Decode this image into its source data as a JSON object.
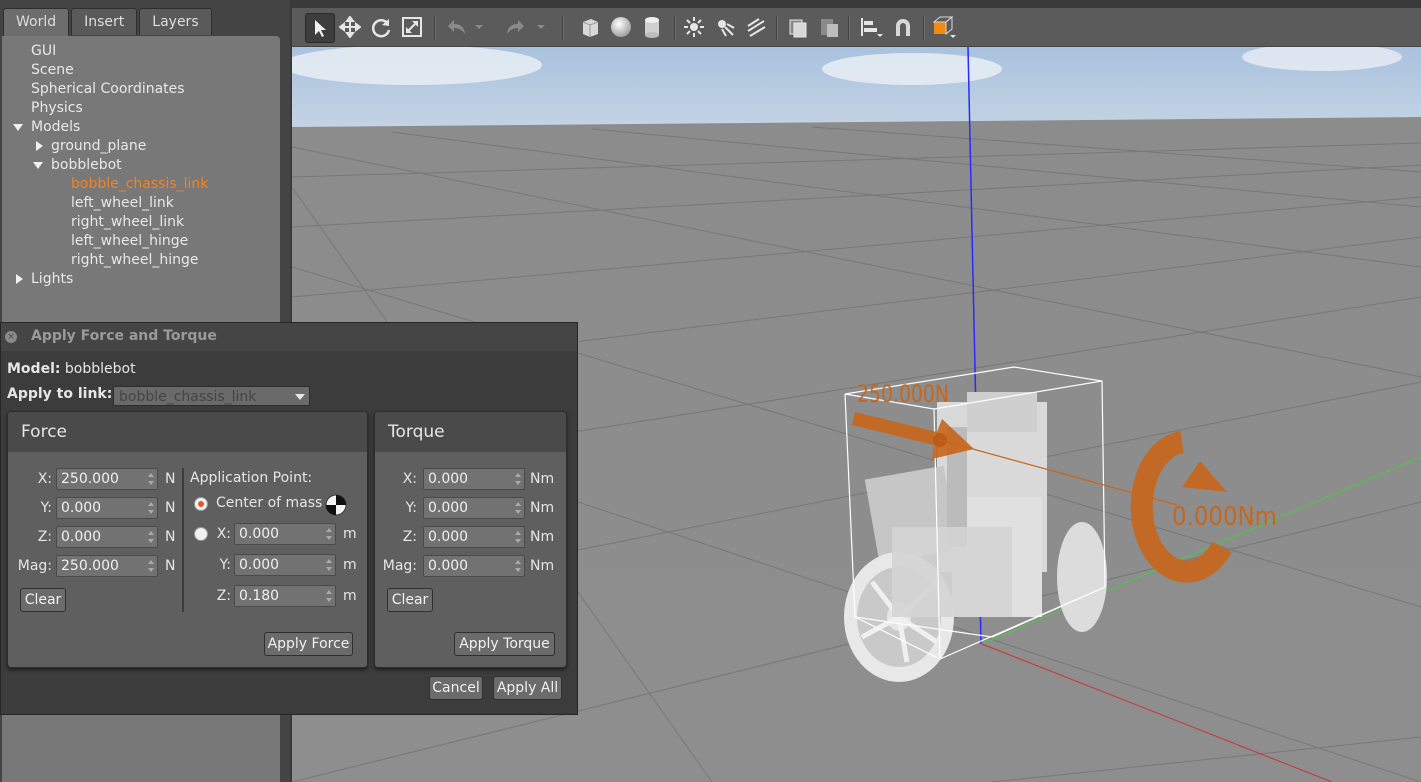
{
  "tabs": [
    "World",
    "Insert",
    "Layers"
  ],
  "tree": {
    "items": [
      {
        "label": "GUI",
        "depth": 0,
        "arrow": "none"
      },
      {
        "label": "Scene",
        "depth": 0,
        "arrow": "none"
      },
      {
        "label": "Spherical Coordinates",
        "depth": 0,
        "arrow": "none"
      },
      {
        "label": "Physics",
        "depth": 0,
        "arrow": "none"
      },
      {
        "label": "Models",
        "depth": 0,
        "arrow": "down"
      },
      {
        "label": "ground_plane",
        "depth": 1,
        "arrow": "right"
      },
      {
        "label": "bobblebot",
        "depth": 1,
        "arrow": "down"
      },
      {
        "label": "bobble_chassis_link",
        "depth": 2,
        "arrow": "none",
        "selected": true
      },
      {
        "label": "left_wheel_link",
        "depth": 2,
        "arrow": "none"
      },
      {
        "label": "right_wheel_link",
        "depth": 2,
        "arrow": "none"
      },
      {
        "label": "left_wheel_hinge",
        "depth": 2,
        "arrow": "none"
      },
      {
        "label": "right_wheel_hinge",
        "depth": 2,
        "arrow": "none"
      },
      {
        "label": "Lights",
        "depth": 0,
        "arrow": "right"
      }
    ]
  },
  "toolbar": {
    "icons": [
      "select-icon",
      "translate-icon",
      "rotate-icon",
      "scale-icon",
      "undo-icon",
      "undo-dropdown-icon",
      "redo-icon",
      "redo-dropdown-icon",
      "box-icon",
      "sphere-icon",
      "cylinder-icon",
      "point-light-icon",
      "spot-light-icon",
      "directional-light-icon",
      "copy-icon",
      "paste-icon",
      "align-icon",
      "snap-icon",
      "view-angle-icon"
    ]
  },
  "viewport": {
    "force_label": "250.000N",
    "torque_label": "0.000Nm",
    "colors": {
      "force": "#c8651a",
      "torque": "#c8651a",
      "z_axis": "#2a2aff",
      "y_axis": "#44cc44",
      "x_axis": "#cc3333"
    }
  },
  "dialog": {
    "title": "Apply Force and Torque",
    "model_label": "Model:",
    "model_value": "bobblebot",
    "apply_link_label": "Apply to link:",
    "apply_link_value": "bobble_chassis_link",
    "force": {
      "title": "Force",
      "rows": [
        {
          "label": "X:",
          "value": "250.000",
          "unit": "N"
        },
        {
          "label": "Y:",
          "value": "0.000",
          "unit": "N"
        },
        {
          "label": "Z:",
          "value": "0.000",
          "unit": "N"
        },
        {
          "label": "Mag:",
          "value": "250.000",
          "unit": "N"
        }
      ],
      "clear": "Clear",
      "apply": "Apply Force",
      "app_point_label": "Application Point:",
      "center_of_mass": "Center of mass",
      "point_rows": [
        {
          "label": "X:",
          "value": "0.000",
          "unit": "m"
        },
        {
          "label": "Y:",
          "value": "0.000",
          "unit": "m"
        },
        {
          "label": "Z:",
          "value": "0.180",
          "unit": "m"
        }
      ]
    },
    "torque": {
      "title": "Torque",
      "rows": [
        {
          "label": "X:",
          "value": "0.000",
          "unit": "Nm"
        },
        {
          "label": "Y:",
          "value": "0.000",
          "unit": "Nm"
        },
        {
          "label": "Z:",
          "value": "0.000",
          "unit": "Nm"
        },
        {
          "label": "Mag:",
          "value": "0.000",
          "unit": "Nm"
        }
      ],
      "clear": "Clear",
      "apply": "Apply Torque"
    },
    "cancel": "Cancel",
    "apply_all": "Apply All"
  }
}
